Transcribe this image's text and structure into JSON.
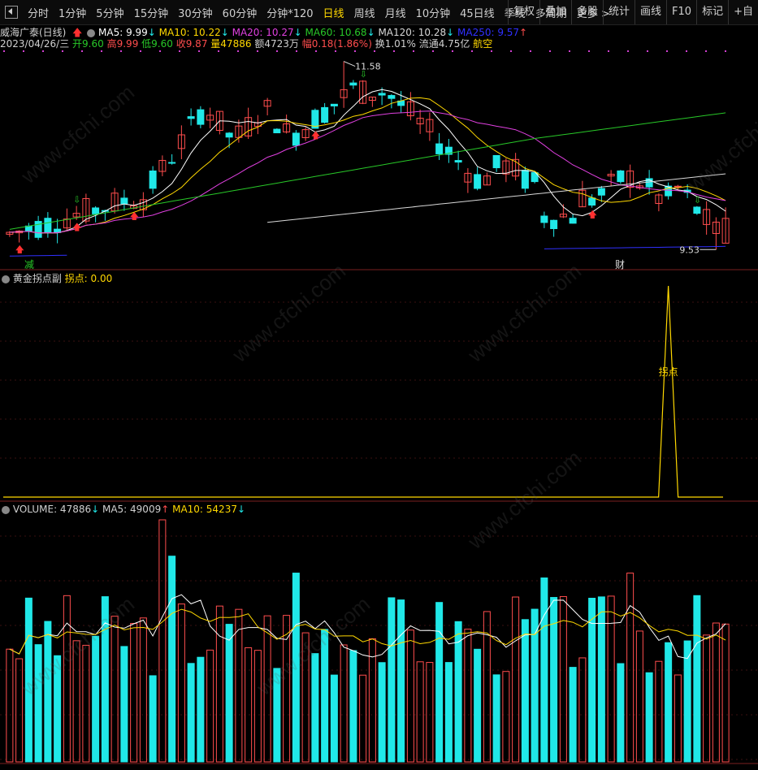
{
  "toolbar": {
    "periods": [
      "分时",
      "1分钟",
      "5分钟",
      "15分钟",
      "30分钟",
      "60分钟",
      "分钟*120",
      "日线",
      "周线",
      "月线",
      "10分钟",
      "45日线",
      "季线",
      "多周期",
      "更多 >"
    ],
    "active_period": "日线",
    "right_tools": [
      "复权",
      "叠加",
      "多股",
      "统计",
      "画线",
      "F10",
      "标记",
      "+自"
    ]
  },
  "header": {
    "stock": "威海广泰(日线)",
    "ma5": "MA5: 9.99",
    "ma10": "MA10: 10.22",
    "ma20": "MA20: 10.27",
    "ma60": "MA60: 10.68",
    "ma120": "MA120: 10.28",
    "ma250": "MA250: 9.57",
    "date": "2023/04/26/三",
    "open": "开9.60",
    "high": "高9.99",
    "low": "低9.60",
    "close": "收9.87",
    "vol": "量47886",
    "amount": "额4723万",
    "change": "幅0.18(1.86%)",
    "turnover": "换1.01%",
    "float_cap": "流通4.75亿",
    "sector": "航空"
  },
  "colors": {
    "up": "#ff4d4d",
    "down": "#20e8e8",
    "ma5": "#ffffff",
    "ma10": "#ffd800",
    "ma20": "#e040e0",
    "ma60": "#28c828",
    "ma120": "#d8d8d8",
    "ma250": "#3030ff"
  },
  "indicator": {
    "title": "黄金拐点副",
    "value_label": "拐点: 0.00",
    "signal_label": "拐点"
  },
  "volume_panel": {
    "vol": "VOLUME: 47886",
    "ma5": "MA5: 49009",
    "ma10": "MA10: 54237"
  },
  "markers": {
    "high_label": "11.58",
    "low_label": "9.53",
    "tag_left": "减",
    "tag_right": "财"
  },
  "watermark": "www.cfchi.com",
  "chart_data": [
    {
      "type": "candlestick",
      "title": "威海广泰(日线)",
      "n_bars": 76,
      "price_range": [
        9.4,
        11.7
      ],
      "max_high": 11.58,
      "min_low": 9.53,
      "last_bar": {
        "open": 9.6,
        "high": 9.99,
        "low": 9.6,
        "close": 9.87
      }
    },
    {
      "type": "line",
      "title": "黄金拐点副",
      "series": [
        {
          "name": "拐点",
          "peak_index": 69,
          "peak_value": 1.0,
          "base_value": 0
        }
      ]
    },
    {
      "type": "bar",
      "title": "VOLUME",
      "values": [
        47886
      ],
      "ma5": 49009,
      "ma10": 54237
    }
  ]
}
